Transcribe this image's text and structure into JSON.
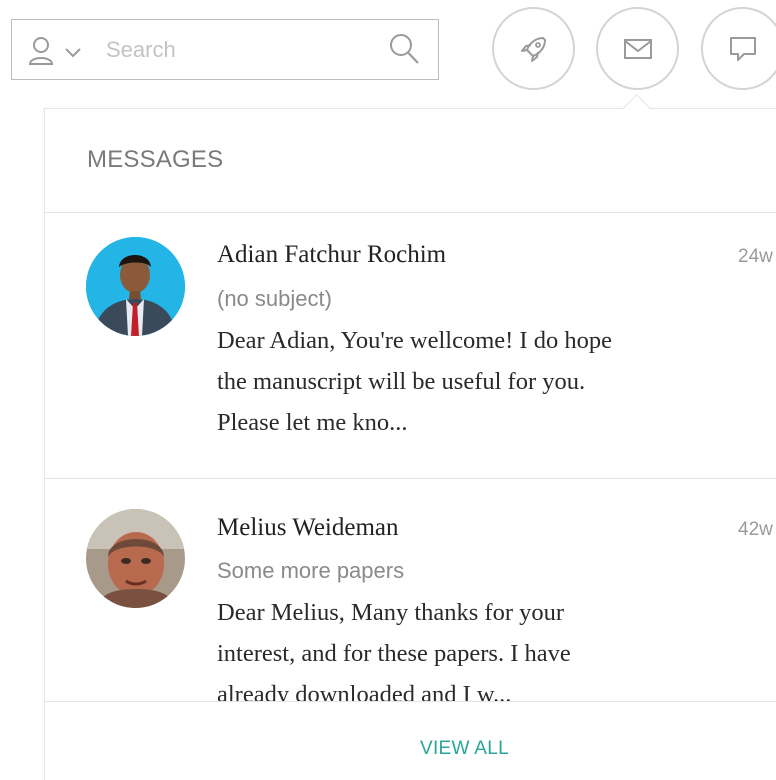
{
  "search": {
    "placeholder": "Search"
  },
  "toolbar": {
    "icons": [
      "rocket-icon",
      "mail-icon",
      "chat-icon"
    ]
  },
  "messages_panel": {
    "title": "MESSAGES",
    "footer_link": "VIEW ALL",
    "accent_color": "#2aa39a",
    "items": [
      {
        "sender": "Adian Fatchur Rochim",
        "subject": "(no subject)",
        "snippet_lines": [
          "Dear Adian, You're wellcome! I do hope",
          "the manuscript will be useful for you.",
          "Please let me kno..."
        ],
        "time": "24w"
      },
      {
        "sender": "Melius Weideman",
        "subject": "Some more papers",
        "snippet_lines": [
          "Dear Melius, Many thanks for your",
          "interest, and for these papers. I have",
          "already downloaded and I w..."
        ],
        "time": "42w"
      }
    ]
  }
}
